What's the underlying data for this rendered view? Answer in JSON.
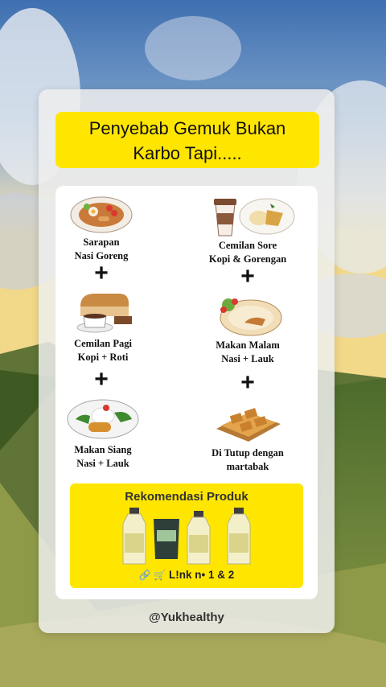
{
  "colors": {
    "accent": "#FFE600",
    "card": "#EEEEEE",
    "text": "#111111"
  },
  "title": {
    "line1": "Penyebab Gemuk Bukan",
    "line2": "Karbo Tapi....."
  },
  "items": {
    "sarapan": {
      "line1": "Sarapan",
      "line2": "Nasi Goreng",
      "icon": "fried-rice-plate-icon"
    },
    "cemilan_sore": {
      "line1": "Cemilan Sore",
      "line2": "Kopi & Gorengan",
      "icon": "coffee-and-fritters-icon"
    },
    "cemilan_pagi": {
      "line1": "Cemilan Pagi",
      "line2": "Kopi + Roti",
      "icon": "coffee-and-bread-icon"
    },
    "makan_malam": {
      "line1": "Makan Malam",
      "line2": "Nasi + Lauk",
      "icon": "rice-and-sides-plate-icon"
    },
    "makan_siang": {
      "line1": "Makan Siang",
      "line2": "Nasi + Lauk",
      "icon": "rice-and-sides-plate-icon"
    },
    "penutup": {
      "line1": "Di Tutup dengan",
      "line2": "martabak",
      "icon": "martabak-icon"
    }
  },
  "plus_sign": "+",
  "promo": {
    "title": "Rekomendasi Produk",
    "link_icons": "🔗 🛒",
    "link_text": "L!nk n• 1 & 2",
    "products": [
      "milk-bottle-icon",
      "milk-bottle-icon",
      "powder-pouch-icon",
      "milk-bottle-icon",
      "milk-bottle-icon"
    ]
  },
  "handle": "@Yukhealthy"
}
